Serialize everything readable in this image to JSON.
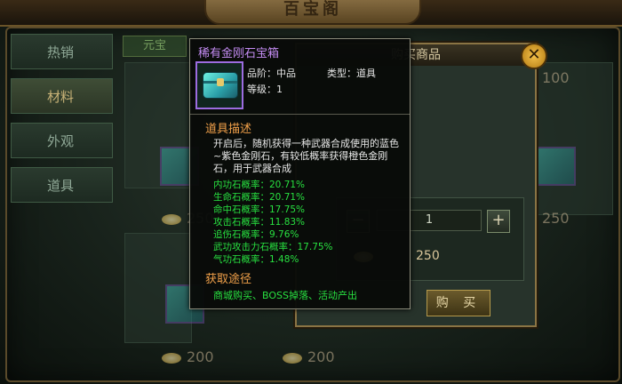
{
  "header": {
    "title": "百宝阁"
  },
  "sidebar": {
    "items": [
      {
        "label": "热销",
        "active": false
      },
      {
        "label": "材料",
        "active": true
      },
      {
        "label": "外观",
        "active": false
      },
      {
        "label": "道具",
        "active": false
      }
    ]
  },
  "shop": {
    "tab_label": "元宝",
    "prices": [
      "100",
      "250",
      "250",
      "200",
      "200"
    ]
  },
  "buy_dialog": {
    "title": "购买商品",
    "quantity": "1",
    "total_price": "250",
    "buy_label": "购  买",
    "close_glyph": "✕"
  },
  "tooltip": {
    "name": "稀有金刚石宝箱",
    "grade_label": "品阶：中品",
    "type_label": "类型：道具",
    "level_label": "等级：1",
    "desc_heading": "道具描述",
    "description": "开启后，随机获得一种武器合成使用的蓝色~紫色金刚石，有较低概率获得橙色金刚石，用于武器合成",
    "rates": [
      "内功石概率：20.71%",
      "生命石概率：20.71%",
      "命中石概率：17.75%",
      "攻击石概率：11.83%",
      "追伤石概率：9.76%",
      "武功攻击力石概率：17.75%",
      "气功石概率：1.48%"
    ],
    "source_heading": "获取途径",
    "source_text": "商城购买、BOSS掉落、活动产出"
  },
  "colors": {
    "item_name": "#c48cf3",
    "heading": "#f2a14a",
    "rate_text": "#28e040"
  }
}
